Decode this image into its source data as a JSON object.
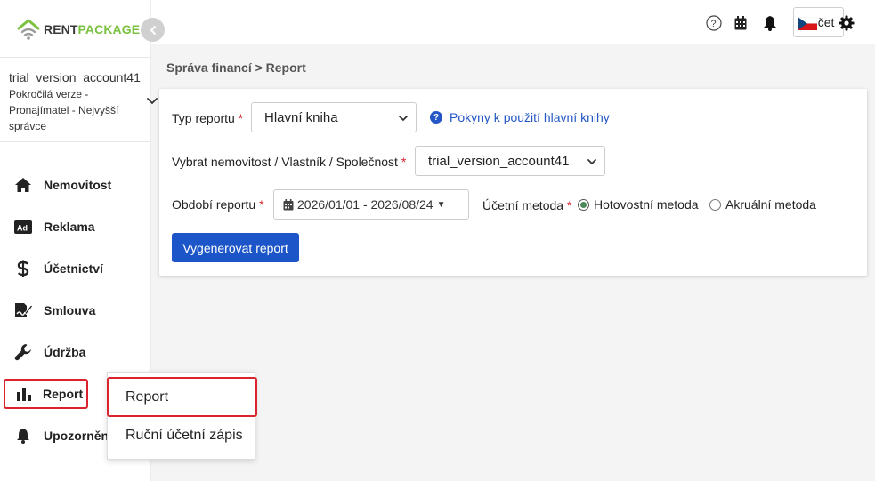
{
  "brand": {
    "rent": "RENT",
    "package": "PACKAGE"
  },
  "account": {
    "name": "trial_version_account41",
    "role": "Pokročilá verze - Pronajímatel - Nejvyšší správce"
  },
  "sidebar": {
    "items": [
      {
        "label": "Nemovitost",
        "icon": "home-icon"
      },
      {
        "label": "Reklama",
        "icon": "ad-icon"
      },
      {
        "label": "Účetnictví",
        "icon": "dollar-icon"
      },
      {
        "label": "Smlouva",
        "icon": "contract-icon"
      },
      {
        "label": "Údržba",
        "icon": "wrench-icon"
      },
      {
        "label": "Report",
        "icon": "bar-chart-icon"
      },
      {
        "label": "Upozorněn",
        "icon": "bell-icon"
      }
    ]
  },
  "topbar": {
    "count_label": "Počet"
  },
  "breadcrumb": "Správa financí > Report",
  "form": {
    "report_type_label": "Typ reportu",
    "report_type_value": "Hlavní kniha",
    "help_link": "Pokyny k použití hlavní knihy",
    "property_label": "Vybrat nemovitost / Vlastník / Společnost",
    "property_value": "trial_version_account41",
    "period_label": "Období reportu",
    "period_value": "2026/01/01 - 2026/08/24",
    "method_label": "Účetní metoda",
    "method_cash": "Hotovostní metoda",
    "method_accrual": "Akruální metoda",
    "generate_label": "Vygenerovat report",
    "required_mark": "*"
  },
  "dropdown": {
    "items": [
      "Report",
      "Ruční účetní zápis"
    ]
  },
  "colors": {
    "accent": "#1b55c8",
    "brand_green": "#7cc242",
    "highlight": "#d9232d"
  }
}
